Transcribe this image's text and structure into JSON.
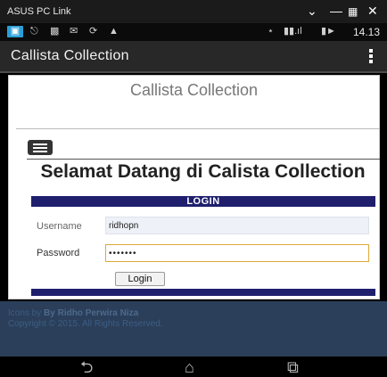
{
  "window": {
    "title": "ASUS PC Link",
    "controls": [
      "minimize-icon",
      "maximize-icon",
      "restore-icon",
      "close-icon"
    ]
  },
  "status_bar": {
    "time": "14.13",
    "icons": [
      "notification-icon",
      "mail-icon",
      "bluetooth-icon",
      "signal-icon",
      "battery-icon"
    ]
  },
  "action_bar": {
    "title": "Callista Collection",
    "menu_icon": "overflow-menu-icon"
  },
  "site": {
    "brand": "Callista Collection",
    "welcome": "Selamat Datang di Calista Collection",
    "login_header": "LOGIN",
    "form": {
      "username_label": "Username",
      "username_value": "ridhopn",
      "password_label": "Password",
      "password_value": "•••••••",
      "submit_label": "Login"
    },
    "footer": {
      "icons_prefix": "Icons by",
      "author": "By Ridho Perwira Niza",
      "copyright": "Copyright © 2015. All Rights Reserved."
    }
  },
  "nav_bar": {
    "buttons": [
      "back-icon",
      "home-icon",
      "recent-apps-icon"
    ]
  }
}
